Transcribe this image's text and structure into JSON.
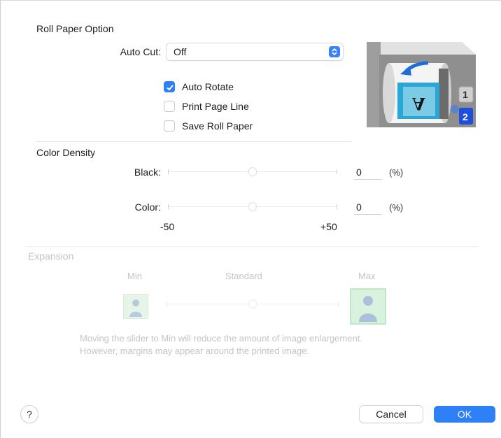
{
  "roll_paper": {
    "title": "Roll Paper Option",
    "auto_cut_label": "Auto Cut:",
    "auto_cut_value": "Off",
    "options": [
      {
        "label": "Auto Rotate",
        "checked": true
      },
      {
        "label": "Print Page Line",
        "checked": false
      },
      {
        "label": "Save Roll Paper",
        "checked": false
      }
    ]
  },
  "printer_illustration": {
    "page_glyph": "A",
    "slot_1": "1",
    "slot_2": "2"
  },
  "color_density": {
    "title": "Color Density",
    "black_label": "Black:",
    "black_value": "0",
    "color_label": "Color:",
    "color_value": "0",
    "unit": "(%)",
    "scale_min": "-50",
    "scale_max": "+50"
  },
  "expansion": {
    "title": "Expansion",
    "min_label": "Min",
    "standard_label": "Standard",
    "max_label": "Max",
    "description_line1": "Moving the slider to Min will reduce the amount of image enlargement.",
    "description_line2": "However, margins may appear around the printed image."
  },
  "footer": {
    "help_label": "?",
    "cancel_label": "Cancel",
    "ok_label": "OK"
  },
  "colors": {
    "accent": "#2f7ff6",
    "disabled_text": "#c4c4c4"
  }
}
